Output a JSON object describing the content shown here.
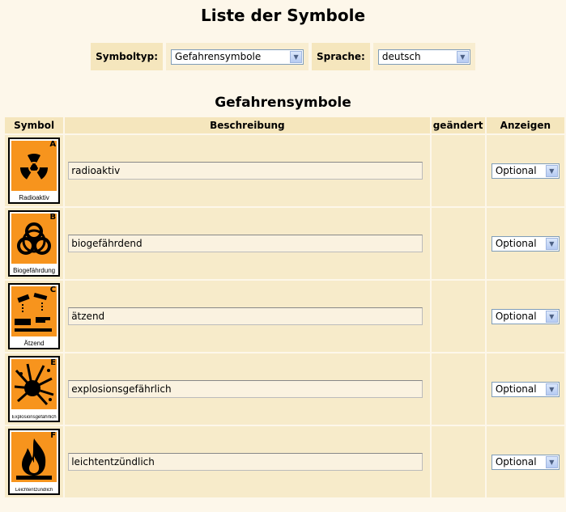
{
  "page": {
    "title": "Liste der Symbole"
  },
  "filters": {
    "symboltyp_label": "Symboltyp:",
    "symboltyp_value": "Gefahrensymbole",
    "sprache_label": "Sprache:",
    "sprache_value": "deutsch"
  },
  "section": {
    "title": "Gefahrensymbole"
  },
  "table": {
    "headers": {
      "symbol": "Symbol",
      "beschreibung": "Beschreibung",
      "geaendert": "geändert",
      "anzeigen": "Anzeigen"
    },
    "rows": [
      {
        "letter": "A",
        "caption": "Radioaktiv",
        "description": "radioaktiv",
        "show": "Optional",
        "icon": "radioactive-icon"
      },
      {
        "letter": "B",
        "caption": "Biogefährdung",
        "description": "biogefährdend",
        "show": "Optional",
        "icon": "biohazard-icon"
      },
      {
        "letter": "C",
        "caption": "Ätzend",
        "description": "ätzend",
        "show": "Optional",
        "icon": "corrosive-icon"
      },
      {
        "letter": "E",
        "caption": "Explosionsgefährlich",
        "description": "explosionsgefährlich",
        "show": "Optional",
        "icon": "explosive-icon"
      },
      {
        "letter": "F",
        "caption": "Leichtentzündlich",
        "description": "leichtentzündlich",
        "show": "Optional",
        "icon": "flame-icon"
      }
    ]
  },
  "colors": {
    "background": "#fdf7ea",
    "header_bg": "#f5e6bd",
    "row_bg": "#f7ebca",
    "sign_orange": "#f7941d"
  }
}
